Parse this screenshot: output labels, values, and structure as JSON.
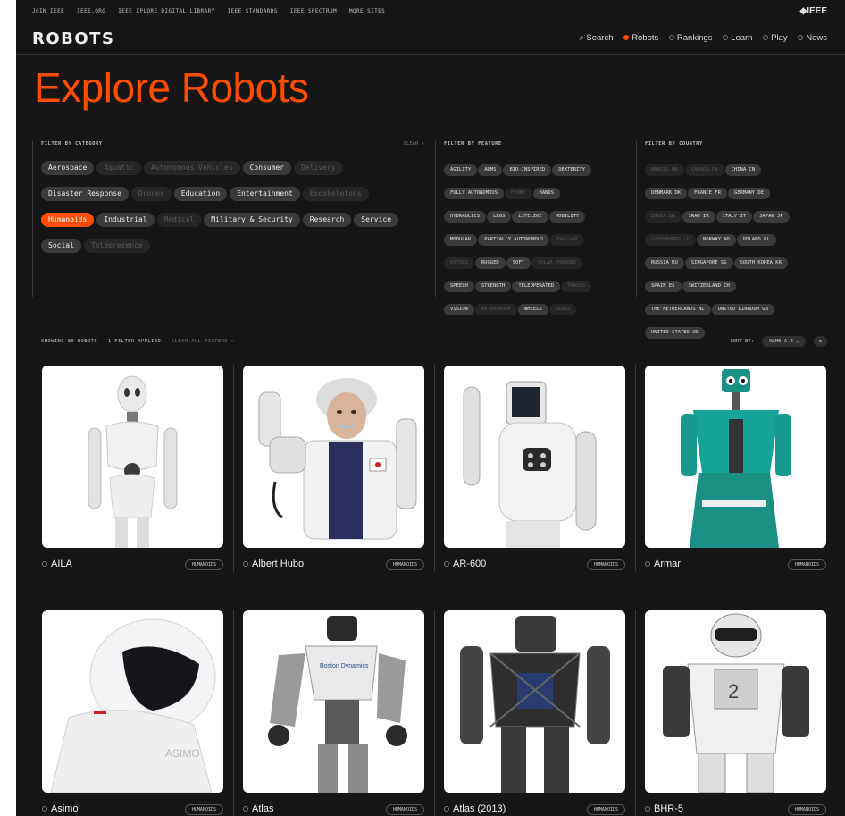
{
  "top_links": [
    "JOIN IEEE",
    "IEEE.ORG",
    "IEEE XPLORE DIGITAL LIBRARY",
    "IEEE STANDARDS",
    "IEEE SPECTRUM",
    "MORE SITES"
  ],
  "ieee_logo": "◆IEEE",
  "logo": "ROBOTS",
  "nav": [
    "Search",
    "Robots",
    "Rankings",
    "Learn",
    "Play",
    "News"
  ],
  "title": "Explore Robots",
  "category": {
    "heading": "FILTER BY CATEGORY",
    "clear": "CLEAR ×",
    "chips": [
      "Aerospace",
      "Aquatic",
      "Autonomous Vehicles",
      "Consumer",
      "Delivery",
      "Disaster Response",
      "Drones",
      "Education",
      "Entertainment",
      "Exoskeletons",
      "Humanoids",
      "Industrial",
      "Medical",
      "Military & Security",
      "Research",
      "Service",
      "Social",
      "Telepresence"
    ]
  },
  "feature": {
    "heading": "FILTER BY FEATURE",
    "chips": [
      "AGILITY",
      "ARMS",
      "BIO-INSPIRED",
      "DEXTERITY",
      "FULLY AUTONOMOUS",
      "FUNNY",
      "HANDS",
      "HYDRAULICS",
      "LEGS",
      "LIFELIKE",
      "MOBILITY",
      "MODULAR",
      "PARTIALLY AUTONOMOUS",
      "PAYLOAD",
      "ROTORS",
      "RUGGED",
      "SOFT",
      "SOLAR-POWERED",
      "SPEECH",
      "STRENGTH",
      "TELEOPERATED",
      "TRACKS",
      "VISION",
      "WATERPROOF",
      "WHEELS",
      "WINGS"
    ]
  },
  "country": {
    "heading": "FILTER BY COUNTRY",
    "chips": [
      "BRAZIL BR",
      "CANADA CA",
      "CHINA CN",
      "DENMARK DK",
      "FRANCE FR",
      "GERMANY DE",
      "INDIA IN",
      "IRAN IR",
      "ITALY IT",
      "JAPAN JP",
      "LUXEMBOURG LU",
      "NORWAY NO",
      "POLAND PL",
      "RUSSIA RU",
      "SINGAPORE SG",
      "SOUTH KOREA KR",
      "SPAIN ES",
      "SWITZERLAND CH",
      "THE NETHERLANDS NL",
      "UNITED KINGDOM GB",
      "UNITED STATES US"
    ]
  },
  "results": {
    "showing": "SHOWING 80 ROBOTS",
    "applied": "1 FILTER APPLIED",
    "clear_all": "CLEAR ALL FILTERS ×",
    "sort_label": "SORT BY:",
    "sort_value": "NAME A-Z ⌄",
    "sort_dir": "⇅"
  },
  "robots": [
    {
      "name": "AILA",
      "tag": "HUMANOIDS"
    },
    {
      "name": "Albert Hubo",
      "tag": "HUMANOIDS"
    },
    {
      "name": "AR-600",
      "tag": "HUMANOIDS"
    },
    {
      "name": "Armar",
      "tag": "HUMANOIDS"
    },
    {
      "name": "Asimo",
      "tag": "HUMANOIDS"
    },
    {
      "name": "Atlas",
      "tag": "HUMANOIDS"
    },
    {
      "name": "Atlas (2013)",
      "tag": "HUMANOIDS"
    },
    {
      "name": "BHR-5",
      "tag": "HUMANOIDS"
    }
  ],
  "colors": {
    "accent": "#ff4d00",
    "background": "#161616",
    "chip": "#3a3a3a"
  }
}
